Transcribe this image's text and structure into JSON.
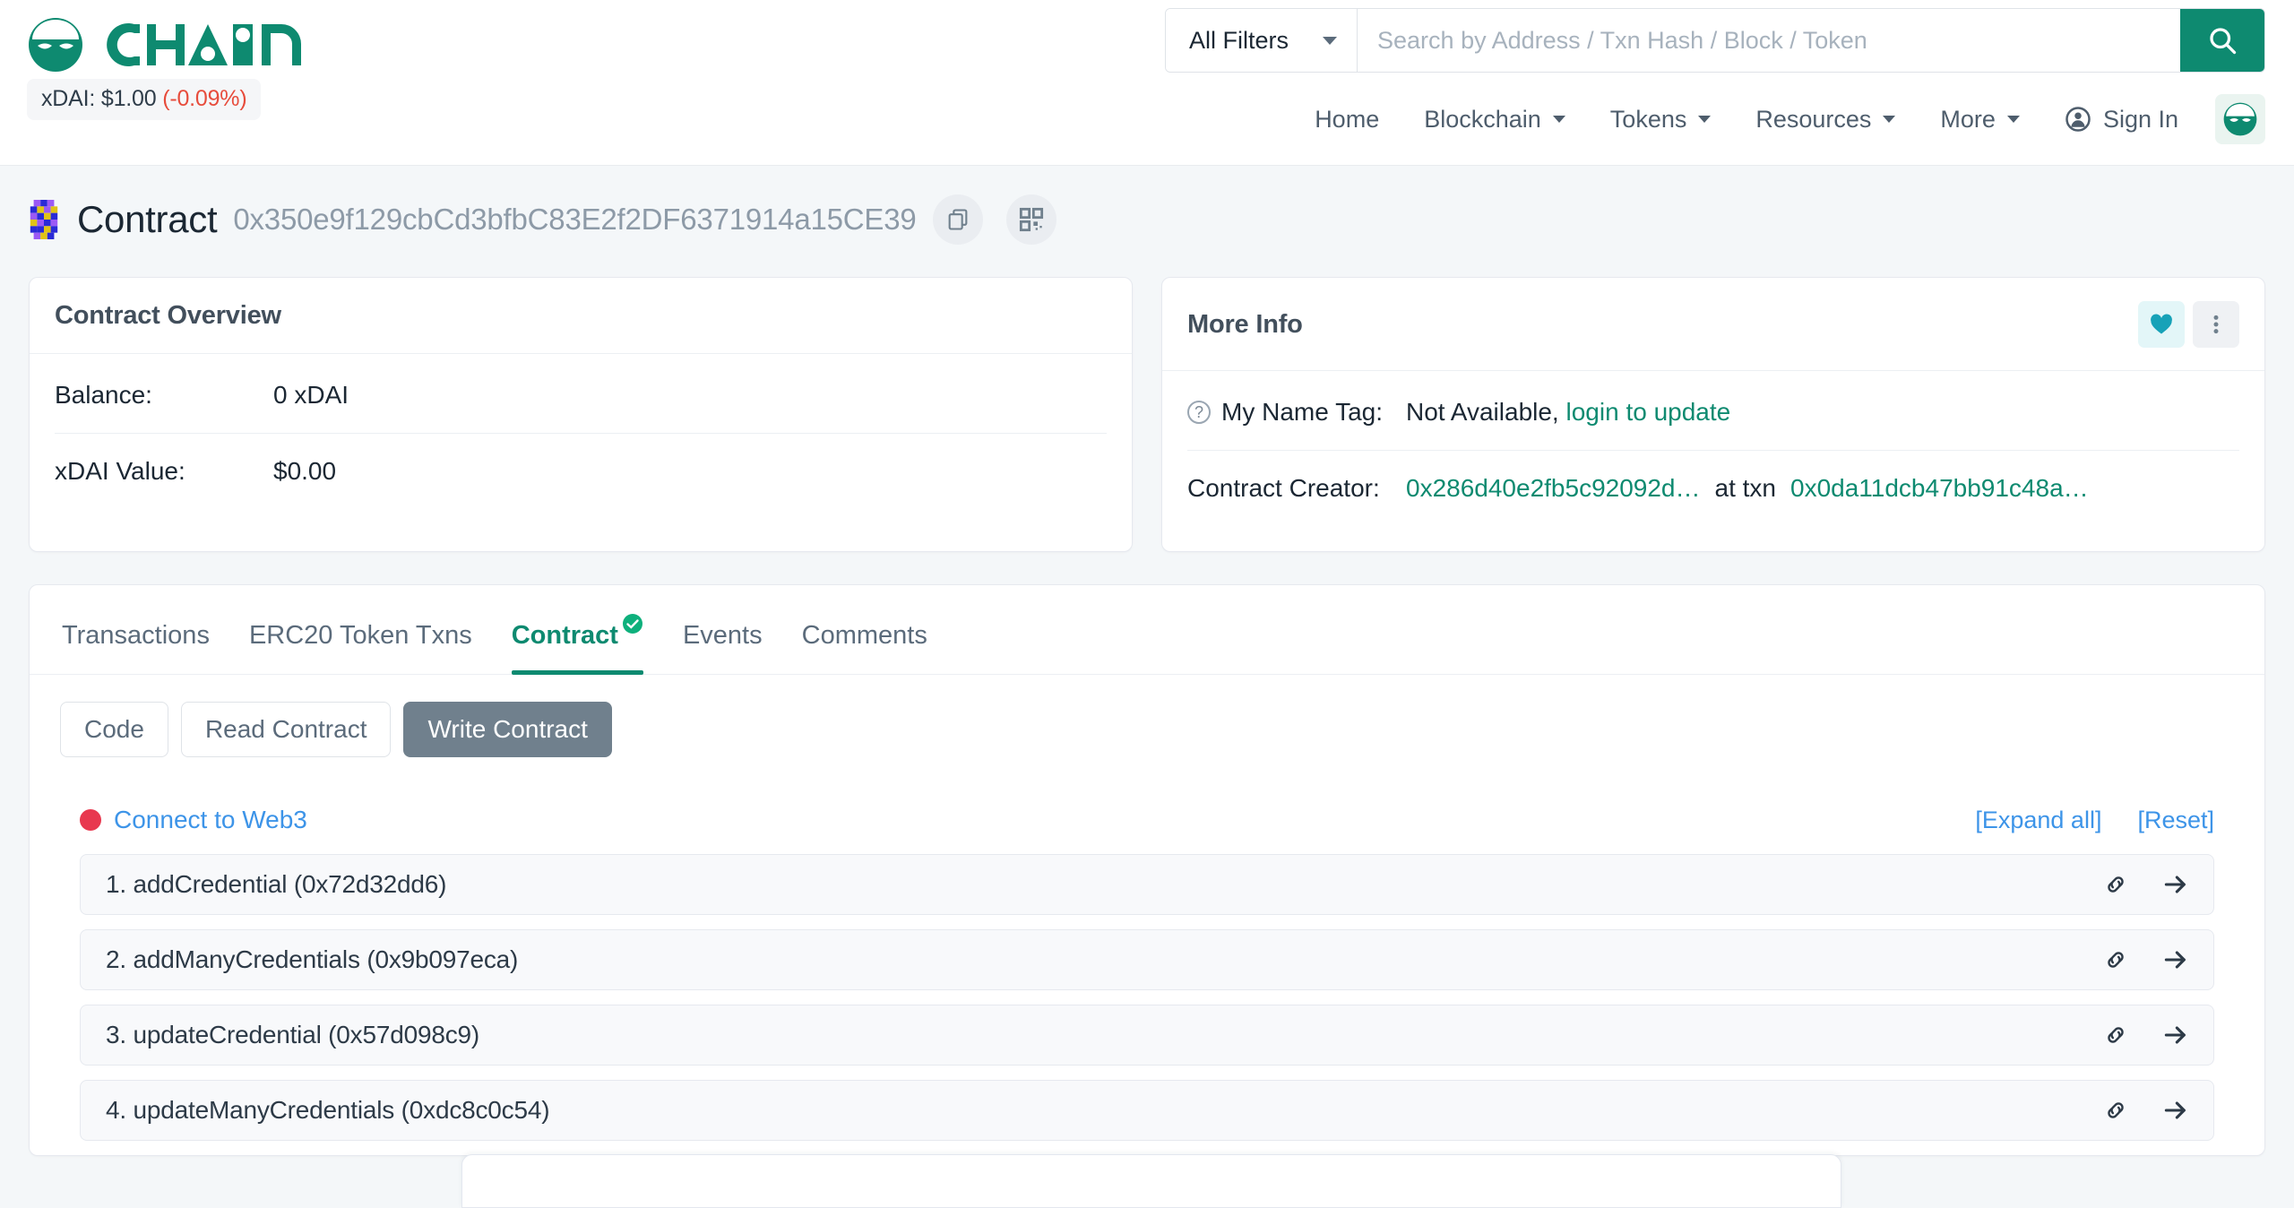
{
  "brand": {
    "wordmark": "CHAIN",
    "owl_icon": "owl-logo-icon",
    "price_label": "xDAI: $1.00",
    "price_change": "(-0.09%)"
  },
  "search": {
    "filter_label": "All Filters",
    "placeholder": "Search by Address / Txn Hash / Block / Token",
    "value": "",
    "submit_icon": "search-icon"
  },
  "nav": {
    "items": [
      {
        "label": "Home",
        "has_caret": false
      },
      {
        "label": "Blockchain",
        "has_caret": true
      },
      {
        "label": "Tokens",
        "has_caret": true
      },
      {
        "label": "Resources",
        "has_caret": true
      },
      {
        "label": "More",
        "has_caret": true
      }
    ],
    "sign_in": "Sign In",
    "sign_in_icon": "user-circle-icon",
    "avatar_icon": "owl-avatar-icon"
  },
  "page": {
    "title": "Contract",
    "address": "0x350e9f129cbCd3bfbC83E2f2DF6371914a15CE39",
    "copy_icon": "copy-icon",
    "qr_icon": "qr-code-icon",
    "identicon": "address-identicon"
  },
  "overview_card": {
    "title": "Contract Overview",
    "rows": [
      {
        "key": "Balance:",
        "value": "0 xDAI"
      },
      {
        "key": "xDAI Value:",
        "value": "$0.00"
      }
    ]
  },
  "more_info_card": {
    "title": "More Info",
    "favorite_icon": "heart-icon",
    "menu_icon": "three-dots-vertical-icon",
    "name_tag": {
      "key": "My Name Tag:",
      "help_icon": "question-mark-icon",
      "value": "Not Available,",
      "link": "login to update"
    },
    "creator": {
      "key": "Contract Creator:",
      "address": "0x286d40e2fb5c92092d…",
      "separator": "at txn",
      "txn": "0x0da11dcb47bb91c48a…"
    }
  },
  "tabs": [
    {
      "label": "Transactions",
      "active": false,
      "verified": false
    },
    {
      "label": "ERC20 Token Txns",
      "active": false,
      "verified": false
    },
    {
      "label": "Contract",
      "active": true,
      "verified": true
    },
    {
      "label": "Events",
      "active": false,
      "verified": false
    },
    {
      "label": "Comments",
      "active": false,
      "verified": false
    }
  ],
  "contract_buttons": [
    {
      "label": "Code",
      "active": false
    },
    {
      "label": "Read Contract",
      "active": false
    },
    {
      "label": "Write Contract",
      "active": true
    }
  ],
  "web3": {
    "status_dot_color": "#e8384f",
    "connect_label": "Connect to Web3",
    "expand_all": "[Expand all]",
    "reset": "[Reset]"
  },
  "functions": [
    {
      "label": "1. addCredential (0x72d32dd6)",
      "link_icon": "chain-link-icon",
      "go_icon": "arrow-right-icon"
    },
    {
      "label": "2. addManyCredentials (0x9b097eca)",
      "link_icon": "chain-link-icon",
      "go_icon": "arrow-right-icon"
    },
    {
      "label": "3. updateCredential (0x57d098c9)",
      "link_icon": "chain-link-icon",
      "go_icon": "arrow-right-icon"
    },
    {
      "label": "4. updateManyCredentials (0xdc8c0c54)",
      "link_icon": "chain-link-icon",
      "go_icon": "arrow-right-icon"
    }
  ],
  "colors": {
    "brand_green": "#0e8a70",
    "link_blue": "#3d94e8",
    "favorite_cyan": "#17a2b8",
    "danger_red": "#e8384f",
    "active_button_gray": "#70808d",
    "page_background": "#f4f7f9"
  }
}
